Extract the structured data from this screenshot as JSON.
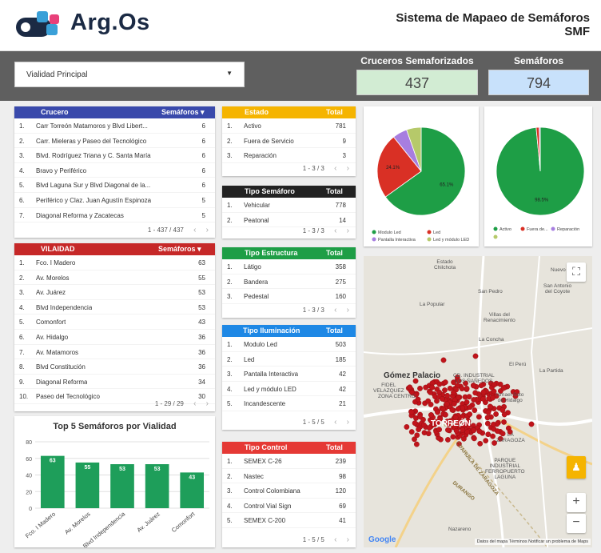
{
  "header": {
    "logo_text": "Arg.Os",
    "title_line1": "Sistema de Mapaeo de Semáforos",
    "title_line2": "SMF"
  },
  "filter": {
    "selected": "Vialidad Principal"
  },
  "kpis": {
    "cruceros_label": "Cruceros Semaforizados",
    "cruceros_value": "437",
    "semaforos_label": "Semáforos",
    "semaforos_value": "794"
  },
  "crucero_table": {
    "col1": "Crucero",
    "col2": "Semáforos",
    "rows": [
      {
        "n": "1.",
        "name": "Carr Torreón Matamoros y Blvd Libert...",
        "v": "6"
      },
      {
        "n": "2.",
        "name": "Carr. Mieleras y Paseo del Tecnológico",
        "v": "6"
      },
      {
        "n": "3.",
        "name": "Blvd. Rodríguez Triana y C. Santa María",
        "v": "6"
      },
      {
        "n": "4.",
        "name": "Bravo y Periférico",
        "v": "6"
      },
      {
        "n": "5.",
        "name": "Blvd Laguna Sur y Blvd Diagonal de la...",
        "v": "6"
      },
      {
        "n": "6.",
        "name": "Periférico y Claz. Juan Agustín Espinoza",
        "v": "5"
      },
      {
        "n": "7.",
        "name": "Diagonal Reforma y Zacatecas",
        "v": "5"
      }
    ],
    "pager": "1 - 437 / 437"
  },
  "vialidad_table": {
    "col1": "VILAIDAD",
    "col2": "Semáforos",
    "rows": [
      {
        "n": "1.",
        "name": "Fco. I Madero",
        "v": "63"
      },
      {
        "n": "2.",
        "name": "Av. Morelos",
        "v": "55"
      },
      {
        "n": "3.",
        "name": "Av. Juárez",
        "v": "53"
      },
      {
        "n": "4.",
        "name": "Blvd Independencia",
        "v": "53"
      },
      {
        "n": "5.",
        "name": "Comonfort",
        "v": "43"
      },
      {
        "n": "6.",
        "name": "Av. Hidalgo",
        "v": "36"
      },
      {
        "n": "7.",
        "name": "Av. Matamoros",
        "v": "36"
      },
      {
        "n": "8.",
        "name": "Blvd Constitución",
        "v": "36"
      },
      {
        "n": "9.",
        "name": "Diagonal Reforma",
        "v": "34"
      },
      {
        "n": "10.",
        "name": "Paseo del Tecnológico",
        "v": "30"
      }
    ],
    "pager": "1 - 29 / 29"
  },
  "estado_table": {
    "col1": "Estado",
    "col2": "Total",
    "rows": [
      {
        "n": "1.",
        "name": "Activo",
        "v": "781"
      },
      {
        "n": "2.",
        "name": "Fuera de Servicio",
        "v": "9"
      },
      {
        "n": "3.",
        "name": "Reparación",
        "v": "3"
      }
    ],
    "pager": "1 - 3 / 3"
  },
  "tipo_semaforo_table": {
    "col1": "Tipo Semáforo",
    "col2": "Total",
    "rows": [
      {
        "n": "1.",
        "name": "Vehicular",
        "v": "778"
      },
      {
        "n": "2.",
        "name": "Peatonal",
        "v": "14"
      }
    ],
    "pager": "1 - 3 / 3"
  },
  "tipo_estructura_table": {
    "col1": "Tipo Estructura",
    "col2": "Total",
    "rows": [
      {
        "n": "1.",
        "name": "Látigo",
        "v": "358"
      },
      {
        "n": "2.",
        "name": "Bandera",
        "v": "275"
      },
      {
        "n": "3.",
        "name": "Pedestal",
        "v": "160"
      }
    ],
    "pager": "1 - 3 / 3"
  },
  "tipo_iluminacion_table": {
    "col1": "Tipo Iluminación",
    "col2": "Total",
    "rows": [
      {
        "n": "1.",
        "name": "Modulo Led",
        "v": "503"
      },
      {
        "n": "2.",
        "name": "Led",
        "v": "185"
      },
      {
        "n": "3.",
        "name": "Pantalla Interactiva",
        "v": "42"
      },
      {
        "n": "4.",
        "name": "Led y módulo LED",
        "v": "42"
      },
      {
        "n": "5.",
        "name": "Incandescente",
        "v": "21"
      }
    ],
    "pager": "1 - 5 / 5"
  },
  "tipo_control_table": {
    "col1": "Tipo Control",
    "col2": "Total",
    "rows": [
      {
        "n": "1.",
        "name": "SEMEX C-26",
        "v": "239"
      },
      {
        "n": "2.",
        "name": "Nastec",
        "v": "98"
      },
      {
        "n": "3.",
        "name": "Control Colombiana",
        "v": "120"
      },
      {
        "n": "4.",
        "name": "Control Vial Sign",
        "v": "69"
      },
      {
        "n": "5.",
        "name": "SEMEX C-200",
        "v": "41"
      }
    ],
    "pager": "1 - 5 / 5"
  },
  "colors": {
    "blue_header": "#3949ab",
    "red_header": "#c62828",
    "yellow_header": "#f5b400",
    "black_header": "#222222",
    "green_header": "#1e9e46",
    "skyblue_header": "#1e88e5",
    "control_header": "#e53935",
    "bar_green": "#1e9e5a",
    "kpi_green": "#d2ecd3",
    "kpi_blue": "#c8e1fb"
  },
  "chart_data": [
    {
      "type": "bar",
      "title": "Top 5 Semáforos por Vialidad",
      "categories": [
        "Fco. I Madero",
        "Av. Morelos",
        "Blvd Independencia",
        "Av. Juárez",
        "Comonfort"
      ],
      "values": [
        63,
        55,
        53,
        53,
        43
      ],
      "yticks": [
        0,
        20,
        40,
        60,
        80
      ],
      "ylim": [
        0,
        80
      ],
      "grid": true
    },
    {
      "type": "pie",
      "labels": [
        "Modulo Led",
        "Led",
        "Pantalla Interactiva",
        "Led y módulo LED"
      ],
      "values": [
        65.1,
        24.1,
        5.4,
        5.4
      ],
      "colors": [
        "#1e9e46",
        "#d93025",
        "#a77ee0",
        "#b6c96a"
      ],
      "slice_labels": [
        "65.1%",
        "24.1%",
        "",
        ""
      ],
      "legend": "bottom"
    },
    {
      "type": "pie",
      "labels": [
        "Activo",
        "Fuera de...",
        "Reparación"
      ],
      "values": [
        98.5,
        1.1,
        0.4
      ],
      "colors": [
        "#1e9e46",
        "#d93025",
        "#a77ee0"
      ],
      "slice_labels": [
        "98.5%",
        "",
        ""
      ],
      "legend": "bottom"
    }
  ],
  "map": {
    "labels": {
      "chilchota": "Estado\nChilchota",
      "nuevo_leon": "Nuevo León",
      "san_antonio": "San Antonio\ndel Coyote",
      "la_popular": "La Popular",
      "san_pedro": "San Pedro",
      "villas": "Villas del\nRenacimiento",
      "la_concha": "La Concha",
      "gomez": "Gómez Palacio",
      "fidel": "FIDEL\nVELAZQUEZ",
      "zona_centro": "ZONA CENTRO",
      "cd_industrial": "CD. INDUSTRIAL\nLOS ÑAÑEDOS",
      "el_peru": "El Perú",
      "la_partida": "La Partida",
      "ismael": "Ismael Soto\nde Hidalgo",
      "torreon": "TORREÓN",
      "la_zaragoza": "LA\nZARAGOZA",
      "parque": "PARQUE\nINDUSTRIAL\nFERROPUERTO\nLAGUNA",
      "coahuila": "COAHUILA DE ZARAGOZA",
      "durango": "DURANGO",
      "nazareno": "Nazareno",
      "google": "Google",
      "attribution": "Datos del mapa   Términos   Notificar un problema de Maps"
    }
  }
}
